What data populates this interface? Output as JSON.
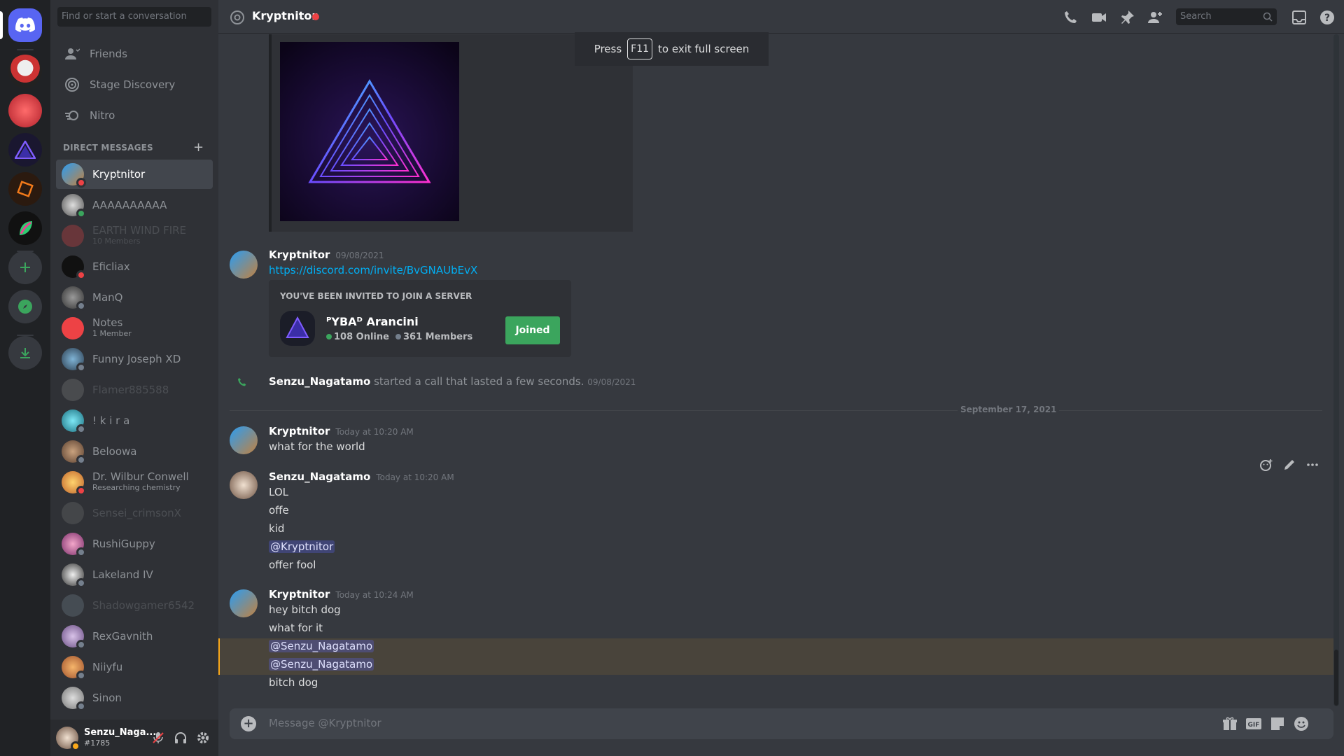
{
  "search": {
    "dm_placeholder": "Find or start a conversation",
    "top_placeholder": "Search"
  },
  "nav": [
    {
      "label": "Friends",
      "icon": "friends-icon"
    },
    {
      "label": "Stage Discovery",
      "icon": "stage-icon"
    },
    {
      "label": "Nitro",
      "icon": "nitro-icon"
    }
  ],
  "dm_header": "DIRECT MESSAGES",
  "dms": [
    {
      "name": "Kryptnitor",
      "status": "dnd"
    },
    {
      "name": "AAAAAAAAAA",
      "status": "online"
    },
    {
      "name": "EARTH WIND FIRE",
      "sub": "10 Members"
    },
    {
      "name": "Eficliax",
      "status": "dnd"
    },
    {
      "name": "ManQ",
      "status": "offline"
    },
    {
      "name": "Notes",
      "sub": "1 Member"
    },
    {
      "name": "Funny Joseph XD",
      "status": "offline"
    },
    {
      "name": "Flamer885588"
    },
    {
      "name": "! k i r a",
      "status": "offline"
    },
    {
      "name": "Beloowa",
      "status": "offline"
    },
    {
      "name": "Dr. Wilbur Conwell",
      "sub": "Researching chemistry",
      "status": "dnd"
    },
    {
      "name": "Sensei_crimsonX"
    },
    {
      "name": "RushiGuppy",
      "status": "offline"
    },
    {
      "name": "Lakeland IV",
      "status": "offline"
    },
    {
      "name": "Shadowgamer6542"
    },
    {
      "name": "RexGavnith",
      "status": "offline"
    },
    {
      "name": "Niiyfu",
      "status": "offline"
    },
    {
      "name": "Sinon",
      "status": "offline"
    }
  ],
  "user": {
    "name": "Senzu_Naga...",
    "tag": "#1785"
  },
  "channel": {
    "name": "Kryptnitor"
  },
  "fullscreen_hint": {
    "before": "Press",
    "key": "F11",
    "after": "to exit full screen"
  },
  "messages": {
    "invite_msg": {
      "author": "Kryptnitor",
      "time": "09/08/2021",
      "link": "https://discord.com/invite/BvGNAUbEvX"
    },
    "invite": {
      "header": "YOU'VE BEEN INVITED TO JOIN A SERVER",
      "server": "ᴾYBAᴰ Arancini",
      "online": "108 Online",
      "members": "361 Members",
      "button": "Joined"
    },
    "call": {
      "who": "Senzu_Nagatamo",
      "text": "started a call that lasted a few seconds.",
      "time": "09/08/2021"
    },
    "date_divider": "September 17, 2021",
    "group1": {
      "author": "Kryptnitor",
      "time": "Today at 10:20 AM",
      "lines": [
        "what for the world"
      ]
    },
    "group2": {
      "author": "Senzu_Nagatamo",
      "time": "Today at 10:20 AM",
      "lines": [
        "LOL",
        "offe",
        "kid",
        "@Kryptnitor",
        "offer fool"
      ]
    },
    "group3": {
      "author": "Kryptnitor",
      "time": "Today at 10:24 AM",
      "lines": [
        "hey bitch dog",
        "what for it",
        "@Senzu_Nagatamo",
        "@Senzu_Nagatamo",
        "bitch dog"
      ]
    }
  },
  "composer": {
    "placeholder": "Message @Kryptnitor"
  },
  "colors": {
    "blurple": "#5865f2",
    "green": "#3ba55d",
    "red": "#ed4245",
    "link": "#00aff4"
  }
}
